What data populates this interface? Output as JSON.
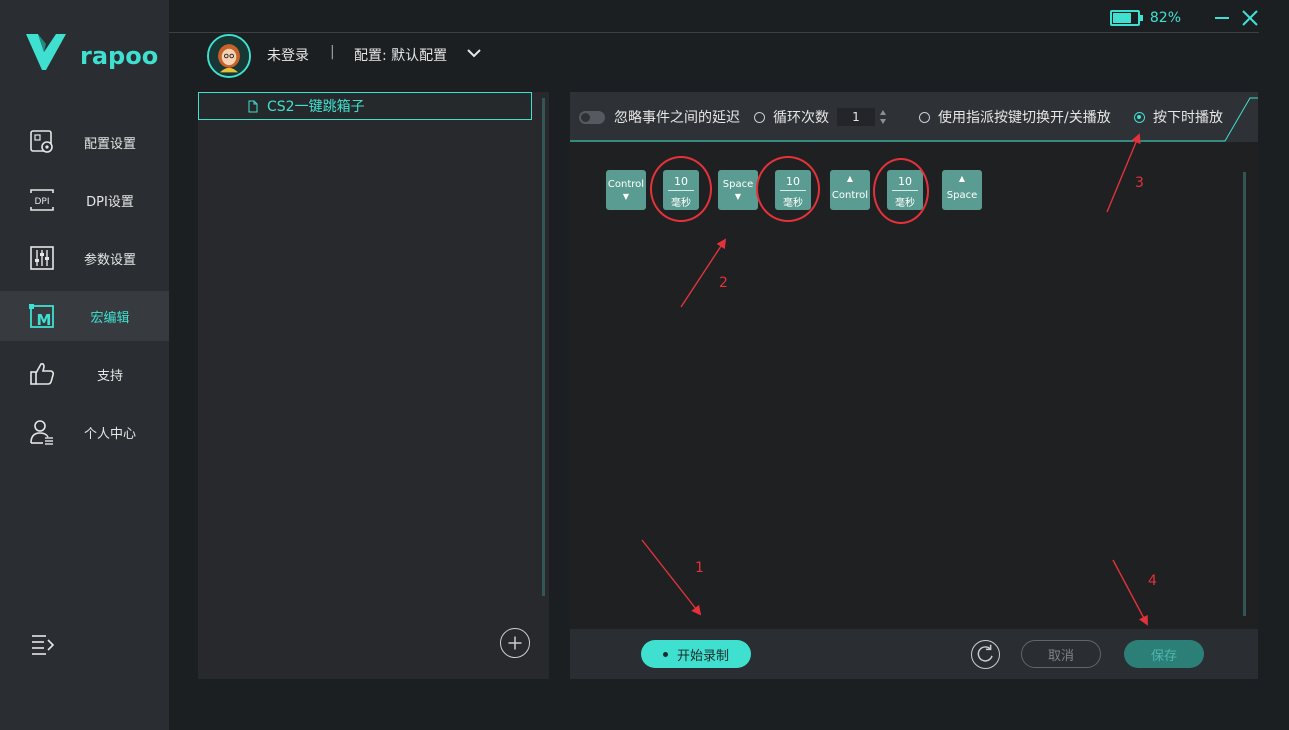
{
  "app": {
    "brand": "rapoo"
  },
  "titlebar": {
    "battery_percent": "82%",
    "battery_level": 0.82
  },
  "user": {
    "name": "未登录",
    "separator": "|",
    "profile_label": "配置: 默认配置"
  },
  "sidebar": {
    "items": [
      {
        "label": "配置设置",
        "icon": "config-icon"
      },
      {
        "label": "DPI设置",
        "icon": "dpi-icon"
      },
      {
        "label": "参数设置",
        "icon": "params-icon"
      },
      {
        "label": "宏编辑",
        "icon": "macro-icon",
        "active": true
      },
      {
        "label": "支持",
        "icon": "thumbs-up-icon"
      },
      {
        "label": "个人中心",
        "icon": "user-icon"
      }
    ]
  },
  "macro_list": {
    "items": [
      {
        "label": "CS2一键跳箱子"
      }
    ]
  },
  "options": {
    "ignore_delay": "忽略事件之间的延迟",
    "loop_count": "循环次数",
    "loop_value": "1",
    "toggle_play": "使用指派按键切换开/关播放",
    "hold_play": "按下时播放"
  },
  "events": [
    {
      "type": "key",
      "key": "Control",
      "direction": "down",
      "arrow": "▼"
    },
    {
      "type": "delay",
      "value": "10",
      "unit": "毫秒"
    },
    {
      "type": "key",
      "key": "Space",
      "direction": "down",
      "arrow": "▼"
    },
    {
      "type": "delay",
      "value": "10",
      "unit": "毫秒"
    },
    {
      "type": "key",
      "key": "Control",
      "direction": "up",
      "arrow": "▲"
    },
    {
      "type": "delay",
      "value": "10",
      "unit": "毫秒"
    },
    {
      "type": "key",
      "key": "Space",
      "direction": "up",
      "arrow": "▲"
    }
  ],
  "buttons": {
    "record": "开始录制",
    "cancel": "取消",
    "save": "保存"
  },
  "annotations": [
    "1",
    "2",
    "3",
    "4"
  ],
  "colors": {
    "accent": "#3fe0d0",
    "annotation": "#e3323a",
    "key_block": "#5a9c92"
  }
}
